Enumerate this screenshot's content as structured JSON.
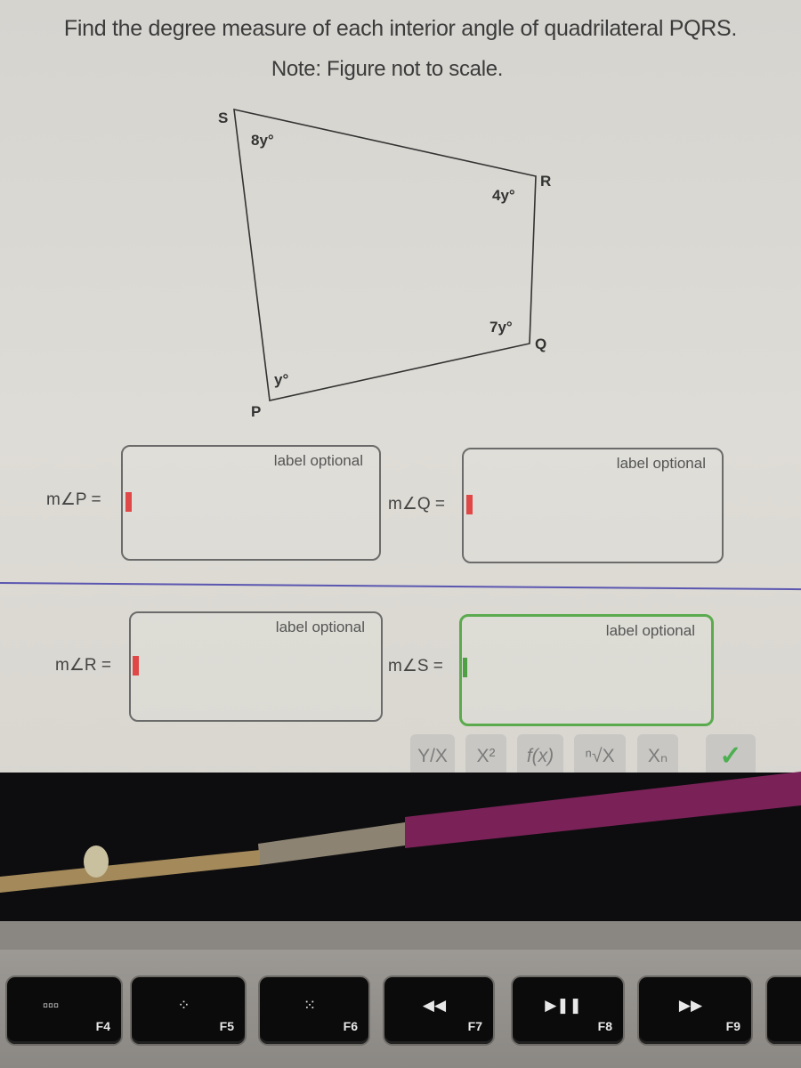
{
  "question": {
    "prompt": "Find the degree measure of each interior angle of quadrilateral PQRS.",
    "note": "Note: Figure not to scale."
  },
  "figure": {
    "vertices": [
      {
        "name": "S",
        "angle_label": "8y°"
      },
      {
        "name": "R",
        "angle_label": "4y°"
      },
      {
        "name": "Q",
        "angle_label": "7y°"
      },
      {
        "name": "P",
        "angle_label": "y°"
      }
    ]
  },
  "answers": [
    {
      "id": "P",
      "label": "m∠P =",
      "placeholder": "label optional",
      "value": "",
      "state": "empty"
    },
    {
      "id": "Q",
      "label": "m∠Q =",
      "placeholder": "label optional",
      "value": "",
      "state": "empty"
    },
    {
      "id": "R",
      "label": "m∠R =",
      "placeholder": "label optional",
      "value": "",
      "state": "empty"
    },
    {
      "id": "S",
      "label": "m∠S =",
      "placeholder": "label optional",
      "value": "",
      "state": "focused"
    }
  ],
  "math_toolbar": {
    "buttons": [
      {
        "id": "fraction",
        "label": "Y/X"
      },
      {
        "id": "power",
        "label": "X²"
      },
      {
        "id": "function",
        "label": "f(x)"
      },
      {
        "id": "root",
        "label": "ⁿ√X"
      },
      {
        "id": "subscript",
        "label": "Xₙ"
      },
      {
        "id": "submit",
        "label": "✓"
      }
    ]
  },
  "keyboard": {
    "keys": [
      {
        "fn": "F4",
        "icon": "launchpad-icon",
        "glyph": "▫▫▫"
      },
      {
        "fn": "F5",
        "icon": "keyboard-brightness-down-icon",
        "glyph": "⁘"
      },
      {
        "fn": "F6",
        "icon": "keyboard-brightness-up-icon",
        "glyph": "⁙"
      },
      {
        "fn": "F7",
        "icon": "rewind-icon",
        "glyph": "◀◀"
      },
      {
        "fn": "F8",
        "icon": "play-pause-icon",
        "glyph": "▶❚❚"
      },
      {
        "fn": "F9",
        "icon": "fast-forward-icon",
        "glyph": "▶▶"
      }
    ]
  },
  "colors": {
    "cursor_empty": "#e04848",
    "active_border": "#5bab4e",
    "divider": "#5b56b0",
    "checkmark": "#4caf50"
  }
}
